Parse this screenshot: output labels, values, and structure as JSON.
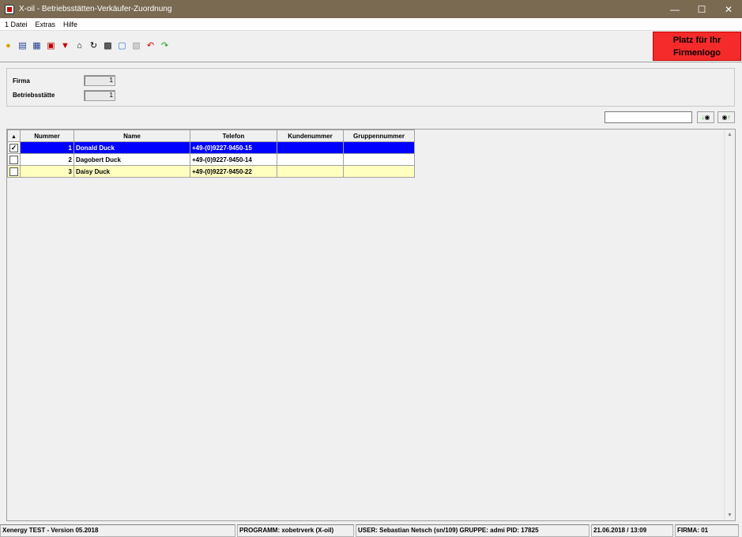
{
  "window": {
    "title": "X-oil - Betriebsstätten-Verkäufer-Zuordnung",
    "controls": [
      "minimize-icon",
      "maximize-icon",
      "close-icon"
    ]
  },
  "menu": [
    "1 Datei",
    "Extras",
    "Hilfe"
  ],
  "toolbar": {
    "icons": [
      "lightbulb-icon",
      "book-info-icon",
      "book-icon",
      "database-icon",
      "filter-icon",
      "home-icon",
      "refresh-icon",
      "print-icon",
      "window-icon",
      "save-icon",
      "undo-icon",
      "redo-icon"
    ]
  },
  "logo": {
    "line1": "Platz für Ihr",
    "line2": "Firmenlogo",
    "color": "#f52b2b"
  },
  "form": {
    "firma_label": "Firma",
    "firma_value": "1",
    "betriebsstaette_label": "Betriebsstätte",
    "betriebsstaette_value": "1"
  },
  "search": {
    "value": "",
    "down_button": "↓",
    "up_button": "↑"
  },
  "grid": {
    "columns": [
      "Nummer",
      "Name",
      "Telefon",
      "Kundenummer",
      "Gruppennummer"
    ],
    "rows": [
      {
        "checked": true,
        "nummer": "1",
        "name": "Donald Duck",
        "telefon": "+49-(0)9227-9450-15",
        "kundenummer": "",
        "gruppennummer": ""
      },
      {
        "checked": false,
        "nummer": "2",
        "name": "Dagobert Duck",
        "telefon": "+49-(0)9227-9450-14",
        "kundenummer": "",
        "gruppennummer": ""
      },
      {
        "checked": false,
        "nummer": "3",
        "name": "Daisy Duck",
        "telefon": "+49-(0)9227-9450-22",
        "kundenummer": "",
        "gruppennummer": ""
      }
    ],
    "selected_color": "#0000ff",
    "alt_row_color": "#ffffc0"
  },
  "status": {
    "version": "Xenergy TEST - Version 05.2018",
    "program": "PROGRAMM: xobetrverk (X-oil)",
    "user": "USER: Sebastian Netsch (sn/109)  GRUPPE: admi  PID: 17825",
    "datetime": "21.06.2018 / 13:09",
    "firma": "FIRMA: 01"
  }
}
